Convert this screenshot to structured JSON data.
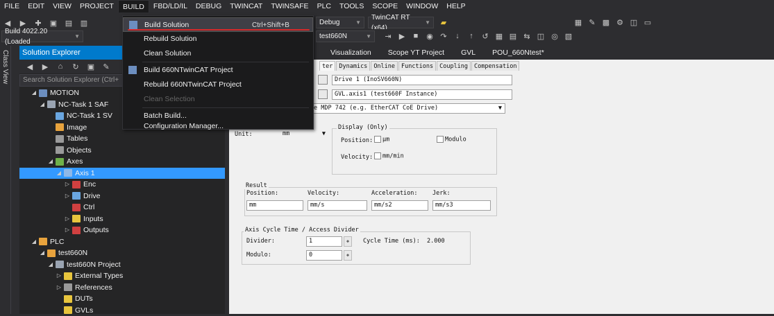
{
  "menubar": {
    "items": [
      "FILE",
      "EDIT",
      "VIEW",
      "PROJECT",
      "BUILD",
      "FBD/LD/IL",
      "DEBUG",
      "TWINCAT",
      "TWINSAFE",
      "PLC",
      "TOOLS",
      "SCOPE",
      "WINDOW",
      "HELP"
    ]
  },
  "toolbar": {
    "config_combo": "Debug",
    "platform_combo": "TwinCAT RT (x64)",
    "build_combo": "Build 4022.20 (Loaded",
    "project_combo": "test660N"
  },
  "side_tab": {
    "label": "Class View"
  },
  "solution_explorer": {
    "title": "Solution Explorer",
    "search_placeholder": "Search Solution Explorer (Ctrl+",
    "tree": [
      {
        "label": "MOTION",
        "indent": 1,
        "twisty": "◢",
        "icon": "motion-icon",
        "color": "#6c8ebf"
      },
      {
        "label": "NC-Task 1 SAF",
        "indent": 2,
        "twisty": "◢",
        "icon": "nc-task-icon",
        "color": "#9aa4b2"
      },
      {
        "label": "NC-Task 1 SV",
        "indent": 3,
        "twisty": "",
        "icon": "nc-task-sv-icon",
        "color": "#6aa6e0"
      },
      {
        "label": "Image",
        "indent": 3,
        "twisty": "",
        "icon": "image-icon",
        "color": "#e8a33d"
      },
      {
        "label": "Tables",
        "indent": 3,
        "twisty": "",
        "icon": "tables-icon",
        "color": "#9a9a9a"
      },
      {
        "label": "Objects",
        "indent": 3,
        "twisty": "",
        "icon": "objects-icon",
        "color": "#9a9a9a"
      },
      {
        "label": "Axes",
        "indent": 3,
        "twisty": "◢",
        "icon": "axes-icon",
        "color": "#6fb04a"
      },
      {
        "label": "Axis 1",
        "indent": 4,
        "twisty": "◢",
        "icon": "axis-icon",
        "color": "#8fb8e8",
        "selected": true
      },
      {
        "label": "Enc",
        "indent": 5,
        "twisty": "▷",
        "icon": "encoder-icon",
        "color": "#d04040"
      },
      {
        "label": "Drive",
        "indent": 5,
        "twisty": "▷",
        "icon": "drive-icon",
        "color": "#6aa6e0"
      },
      {
        "label": "Ctrl",
        "indent": 5,
        "twisty": "",
        "icon": "ctrl-icon",
        "color": "#d04040"
      },
      {
        "label": "Inputs",
        "indent": 5,
        "twisty": "▷",
        "icon": "inputs-icon",
        "color": "#e8c53d"
      },
      {
        "label": "Outputs",
        "indent": 5,
        "twisty": "▷",
        "icon": "outputs-icon",
        "color": "#d04040"
      },
      {
        "label": "PLC",
        "indent": 1,
        "twisty": "◢",
        "icon": "plc-icon",
        "color": "#e8a33d"
      },
      {
        "label": "test660N",
        "indent": 2,
        "twisty": "◢",
        "icon": "plc-project-icon",
        "color": "#e8a33d"
      },
      {
        "label": "test660N Project",
        "indent": 3,
        "twisty": "◢",
        "icon": "project-icon",
        "color": "#9aa4b2"
      },
      {
        "label": "External Types",
        "indent": 4,
        "twisty": "▷",
        "icon": "folder-icon",
        "color": "#e8c53d"
      },
      {
        "label": "References",
        "indent": 4,
        "twisty": "▷",
        "icon": "references-icon",
        "color": "#9a9a9a"
      },
      {
        "label": "DUTs",
        "indent": 4,
        "twisty": "",
        "icon": "folder-icon",
        "color": "#e8c53d"
      },
      {
        "label": "GVLs",
        "indent": 4,
        "twisty": "",
        "icon": "folder-icon",
        "color": "#e8c53d"
      }
    ]
  },
  "doc_tabs": [
    "Visualization",
    "Scope YT Project",
    "GVL",
    "POU_660Ntest*"
  ],
  "editor": {
    "inner_tabs": [
      "ter",
      "Dynamics",
      "Online",
      "Functions",
      "Coupling",
      "Compensation"
    ],
    "link_drive": "Drive 1 (InoSV660N)",
    "link_plc": "GVL.axis1 (test660F Instance)",
    "profile_combo": "02/Profile MDP 742 (e.g. EtherCAT CoE Drive)",
    "unit_label": "Unit:",
    "unit_value": "mm",
    "display_legend": "Display (Only)",
    "position_label": "Position:",
    "position_unit": "μm",
    "modulo_label": "Modulo",
    "velocity_label": "Velocity:",
    "velocity_unit": "mm/min",
    "result_legend": "Result",
    "result_headers": [
      "Position:",
      "Velocity:",
      "Acceleration:",
      "Jerk:"
    ],
    "result_values": [
      "mm",
      "mm/s",
      "mm/s2",
      "mm/s3"
    ],
    "cycle_legend": "Axis Cycle Time / Access Divider",
    "divider_label": "Divider:",
    "divider_value": "1",
    "cycle_time_label": "Cycle Time (ms):",
    "cycle_time_value": "2.000",
    "modulo2_label": "Modulo:",
    "modulo2_value": "0"
  },
  "build_menu": {
    "items": [
      {
        "label": "Build Solution",
        "shortcut": "Ctrl+Shift+B",
        "highlight": true
      },
      {
        "label": "Rebuild Solution"
      },
      {
        "label": "Clean Solution"
      },
      {
        "label": "Build 660NTwinCAT Project",
        "icon": true
      },
      {
        "label": "Rebuild 660NTwinCAT Project"
      },
      {
        "label": "Clean Selection",
        "disabled": true
      },
      {
        "label": "Batch Build..."
      },
      {
        "label": "Configuration Manager..."
      }
    ]
  }
}
